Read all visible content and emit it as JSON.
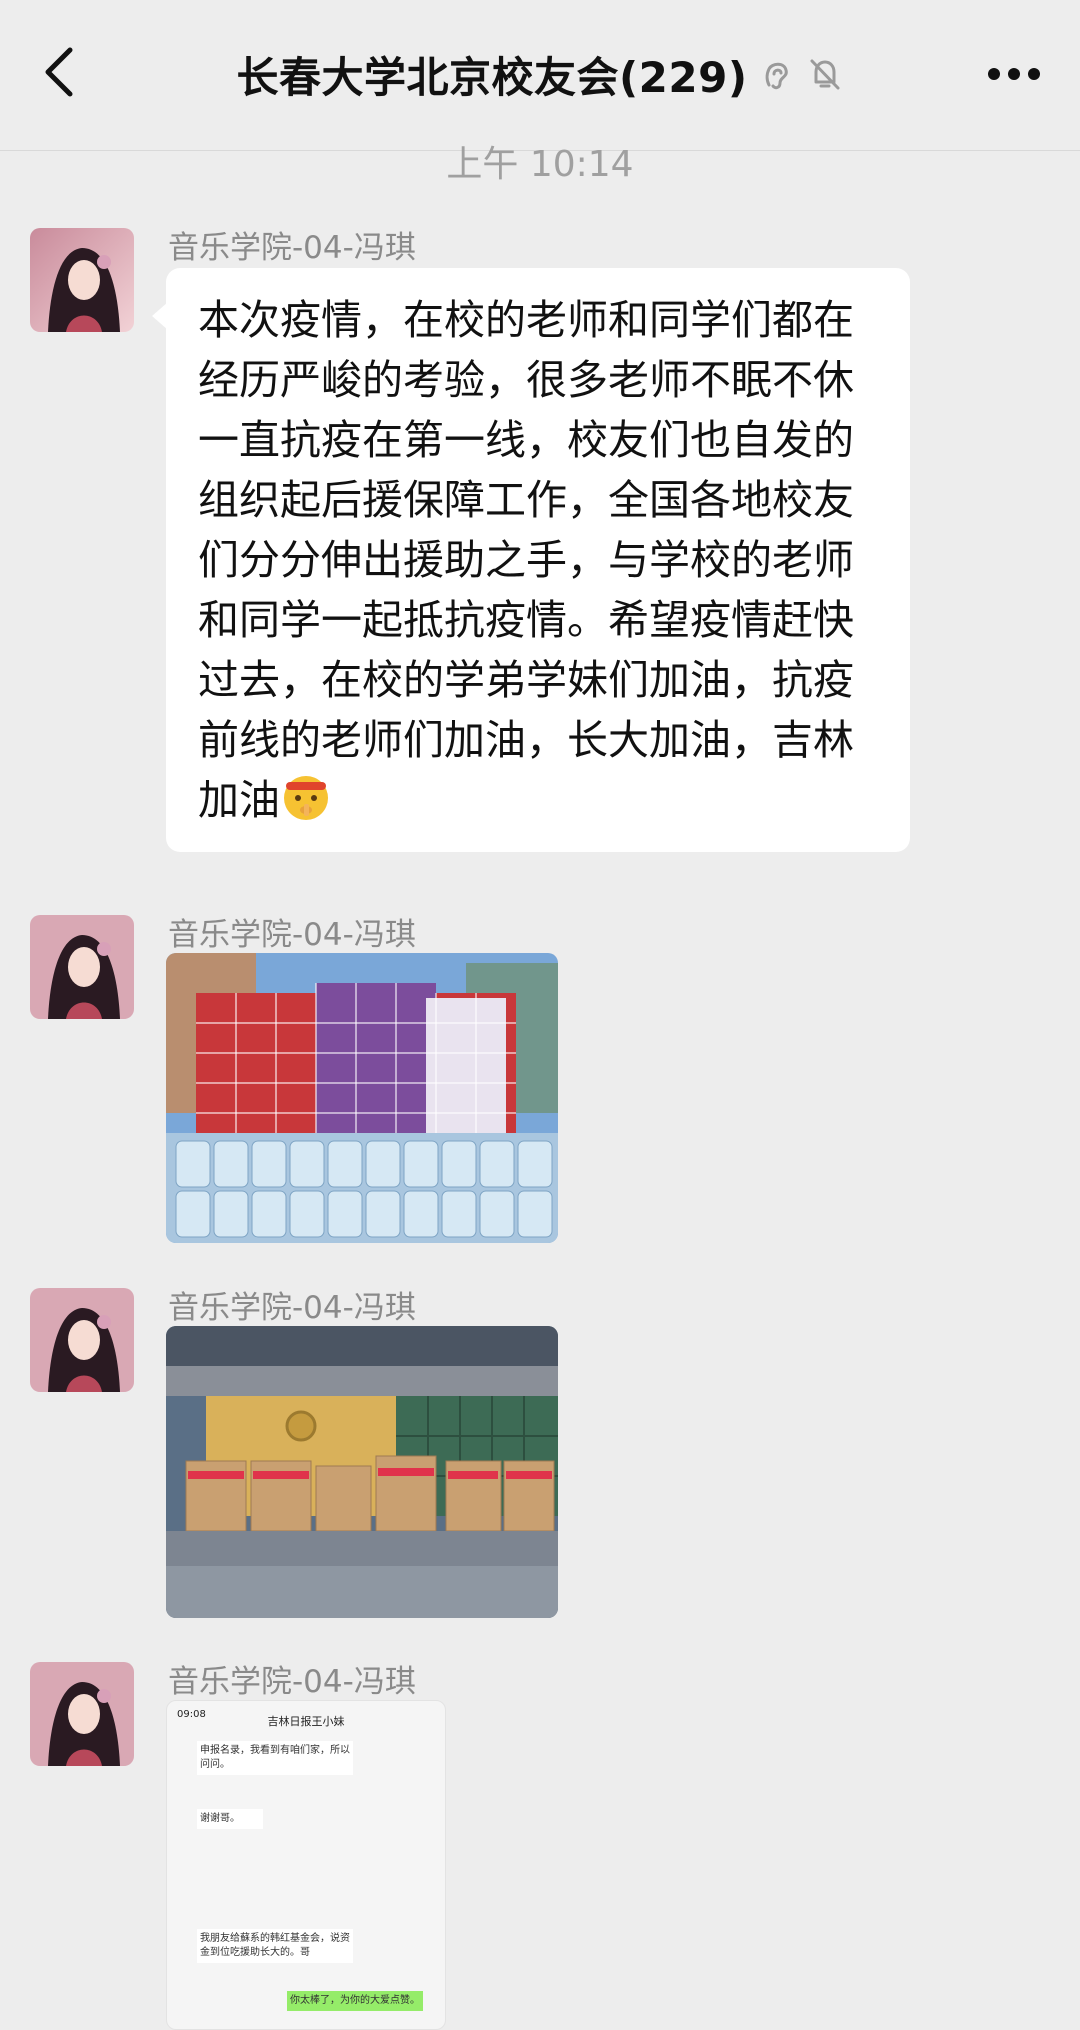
{
  "header": {
    "title": "长春大学北京校友会(229)",
    "back_icon": "chevron-left-icon",
    "ear_icon": "ear-icon",
    "mute_icon": "bell-mute-icon",
    "more_icon": "more-dots-icon"
  },
  "timestamp": "上午 10:14",
  "messages": [
    {
      "sender": "音乐学院-04-冯琪",
      "type": "text",
      "text": "本次疫情，在校的老师和同学们都在经历严峻的考验，很多老师不眠不休一直抗疫在第一线，校友们也自发的组织起后援保障工作，全国各地校友们分分伸出援助之手，与学校的老师和同学一起抵抗疫情。希望疫情赶快过去，在校的学弟学妹们加油，抗疫前线的老师们加油，长大加油，吉林加油",
      "emoji": "face-with-headband-shushing-emoji"
    },
    {
      "sender": "音乐学院-04-冯琪",
      "type": "image",
      "image_desc": "photo-boxes-and-water-bottles"
    },
    {
      "sender": "音乐学院-04-冯琪",
      "type": "image",
      "image_desc": "photo-supplies-in-front-of-building"
    },
    {
      "sender": "音乐学院-04-冯琪",
      "type": "image",
      "image_desc": "screenshot-of-chat",
      "shot": {
        "time": "09:08",
        "title": "吉林日报王小妹",
        "line1": "申报名录，我看到有咱们家，所以问问。",
        "line2": "谢谢哥。",
        "line3": "我朋友给蘇系的韩红基金会，说资金到位吃援助长大的。哥",
        "line4": "你太棒了，为你的大爱点赞。"
      }
    }
  ],
  "colors": {
    "background": "#ededed",
    "bubble": "#ffffff",
    "sender_text": "#8a8a8a",
    "time_text": "#a0a0a0"
  }
}
